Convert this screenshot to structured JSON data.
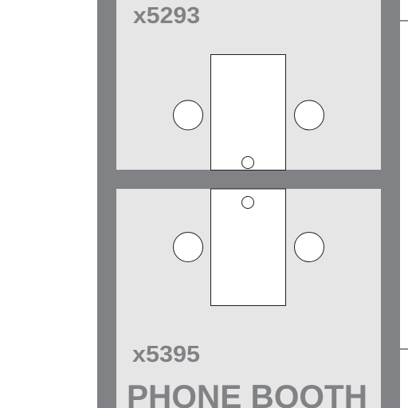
{
  "rooms": [
    {
      "extension": "x5293"
    },
    {
      "extension": "x5395",
      "name": "PHONE BOOTH"
    }
  ],
  "colors": {
    "wall": "#808285",
    "room_fill": "#e6e6e6",
    "background": "#ffffff",
    "furniture_stroke": "#231f20",
    "furniture_fill": "#ffffff"
  },
  "icons": {
    "desk": "rectangle-table",
    "seat": "circle-chair",
    "phone": "small-circle"
  }
}
